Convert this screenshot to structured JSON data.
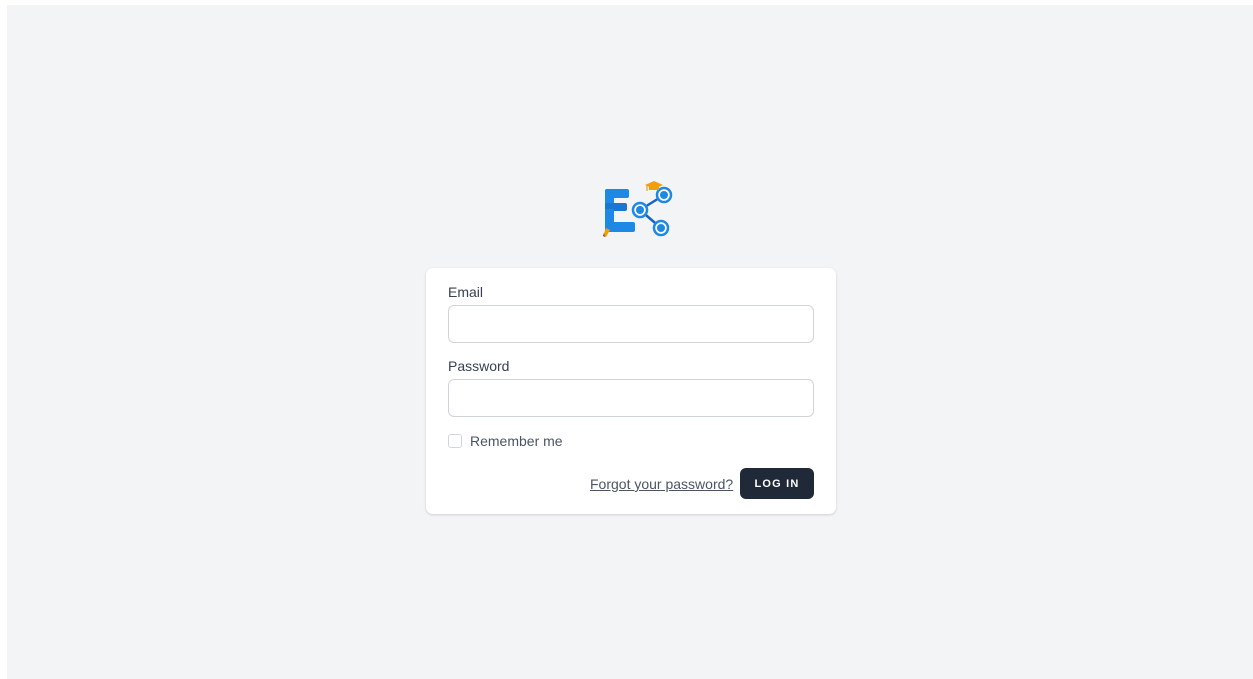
{
  "logo": {
    "icon": "app-logo-icon"
  },
  "form": {
    "email_label": "Email",
    "email_value": "",
    "email_placeholder": "",
    "password_label": "Password",
    "password_value": "",
    "password_placeholder": "",
    "remember_label": "Remember me",
    "remember_checked": false,
    "forgot_link": "Forgot your password?",
    "login_button": "LOG IN"
  },
  "colors": {
    "background": "#f3f4f6",
    "card": "#ffffff",
    "button": "#1f2937",
    "logo_blue": "#1e88e5",
    "logo_orange": "#f59e0b"
  }
}
